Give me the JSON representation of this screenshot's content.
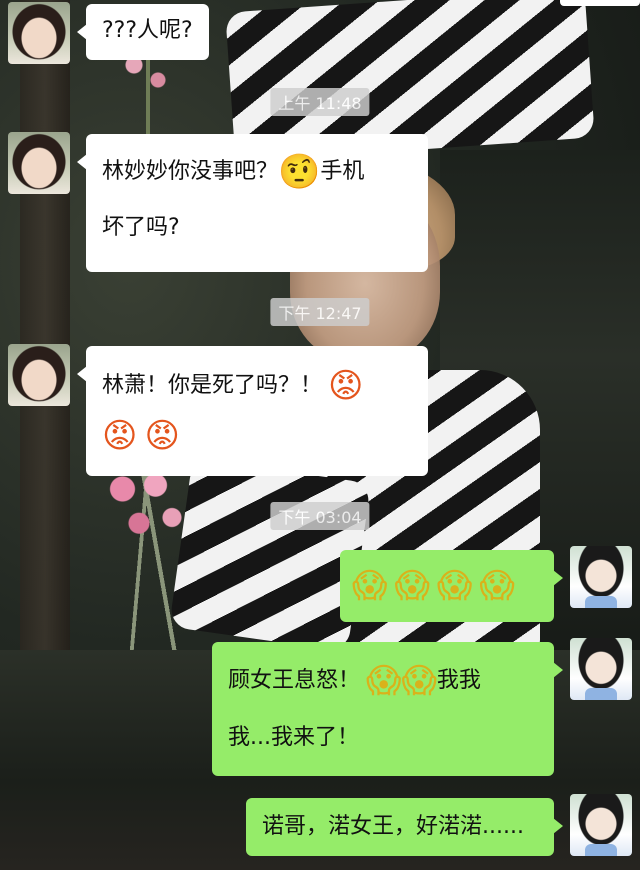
{
  "messages": [
    {
      "id": "m1",
      "side": "left",
      "parts": [
        {
          "text": "???人呢?"
        }
      ]
    },
    {
      "id": "m2",
      "side": "left",
      "line1": "林妙妙你没事吧？",
      "line1_emoji": "🤨",
      "line1_tail": "手机",
      "line2": "坏了吗?"
    },
    {
      "id": "m3",
      "side": "left",
      "line1": "林萧！你是死了吗？！",
      "line1_emoji": "😡",
      "line2_emojis": [
        "😡",
        "😡"
      ]
    },
    {
      "id": "m4",
      "side": "right",
      "emojis": [
        "😱",
        "😱",
        "😱",
        "😱"
      ]
    },
    {
      "id": "m5",
      "side": "right",
      "line1": "顾女王息怒！",
      "line1_emojis": [
        "😱",
        "😱"
      ],
      "line1_tail": "我我",
      "line2": "我...我来了！"
    },
    {
      "id": "m6",
      "side": "right",
      "text": "诺哥，渃女王，好渃渃......"
    }
  ],
  "timestamps": {
    "t1": "上午 11:48",
    "t2": "下午 12:47",
    "t3": "下午 03:04"
  },
  "icons": {
    "angry": "angry-face-emoji",
    "scream": "screaming-face-emoji",
    "skeptic": "raised-eyebrow-emoji"
  },
  "colors": {
    "incoming_bubble": "#ffffff",
    "outgoing_bubble": "#95ec69",
    "timestamp_bg": "#cdcdcd"
  }
}
